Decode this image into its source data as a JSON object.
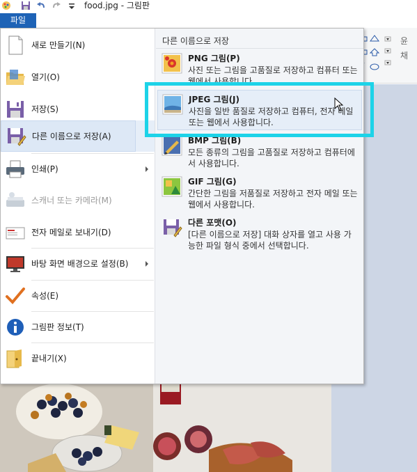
{
  "window": {
    "title": "food.jpg - 그림판"
  },
  "ribbon": {
    "file_tab": "파일",
    "right_labels": [
      "윤",
      "채",
      "형"
    ]
  },
  "menu": {
    "items": [
      {
        "id": "new",
        "label": "새로 만들기(N)",
        "icon": "new-document-icon"
      },
      {
        "id": "open",
        "label": "열기(O)",
        "icon": "folder-icon"
      },
      {
        "id": "save",
        "label": "저장(S)",
        "icon": "floppy-disk-icon"
      },
      {
        "id": "save-as",
        "label": "다른 이름으로 저장(A)",
        "icon": "save-as-icon",
        "submenu": true,
        "selected": true
      },
      {
        "id": "print",
        "label": "인쇄(P)",
        "icon": "printer-icon",
        "submenu": true
      },
      {
        "id": "scanner",
        "label": "스캐너 또는 카메라(M)",
        "icon": "scanner-icon",
        "disabled": true
      },
      {
        "id": "email",
        "label": "전자 메일로 보내기(D)",
        "icon": "envelope-icon"
      },
      {
        "id": "wallpaper",
        "label": "바탕 화면 배경으로 설정(B)",
        "icon": "monitor-icon",
        "submenu": true
      },
      {
        "id": "properties",
        "label": "속성(E)",
        "icon": "checkmark-icon"
      },
      {
        "id": "about",
        "label": "그림판 정보(T)",
        "icon": "info-icon"
      },
      {
        "id": "exit",
        "label": "끝내기(X)",
        "icon": "exit-folder-icon"
      }
    ]
  },
  "submenu": {
    "header": "다른 이름으로 저장",
    "items": [
      {
        "id": "png",
        "title": "PNG 그림(P)",
        "description": "사진 또는 그림을 고품질로 저장하고 컴퓨터 또는 웹에서 사용합니다.",
        "icon": "png-image-icon"
      },
      {
        "id": "jpeg",
        "title": "JPEG 그림(J)",
        "description": "사진을 일반 품질로 저장하고 컴퓨터, 전자 메일 또는 웹에서 사용합니다.",
        "icon": "jpeg-image-icon",
        "selected": true
      },
      {
        "id": "bmp",
        "title": "BMP 그림(B)",
        "description": "모든 종류의 그림을 고품질로 저장하고 컴퓨터에서 사용합니다.",
        "icon": "bmp-image-icon"
      },
      {
        "id": "gif",
        "title": "GIF 그림(G)",
        "description": "간단한 그림을 저품질로 저장하고 전자 메일 또는 웹에서 사용합니다.",
        "icon": "gif-image-icon"
      },
      {
        "id": "other",
        "title": "다른 포맷(O)",
        "description": "[다른 이름으로 저장] 대화 상자를 열고 사용 가능한 파일 형식 중에서 선택합니다.",
        "icon": "other-format-icon"
      }
    ]
  },
  "colors": {
    "file_tab": "#1e63b6",
    "highlight": "#1dd3e8",
    "selected_bg": "#dde8f6"
  }
}
